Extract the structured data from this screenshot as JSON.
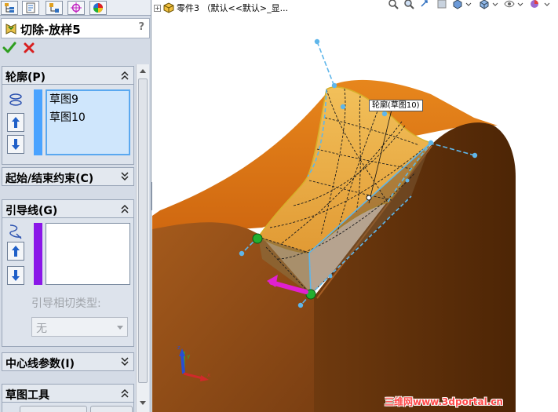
{
  "property_manager": {
    "feature_title": "切除-放样5",
    "help_label": "?",
    "groups": {
      "profile": {
        "title": "轮廓(P)",
        "items": [
          "草图9",
          "草图10"
        ]
      },
      "start_end": {
        "title": "起始/结束约束(C)"
      },
      "guides": {
        "title": "引导线(G)",
        "tangent_type_label": "引导相切类型:",
        "tangent_type_value": "无"
      },
      "centerline": {
        "title": "中心线参数(I)"
      },
      "sketch_tools": {
        "title": "草图工具"
      }
    },
    "colors": {
      "profile_bar": "#4aa3ff",
      "guide_bar": "#8a17e8",
      "ok": "#2e9e1f",
      "cancel": "#d81e1e"
    },
    "icons": [
      "ok-check-icon",
      "cancel-x-icon",
      "collapse-up-icon",
      "collapse-down-icon",
      "move-up-arrow-icon",
      "move-down-arrow-icon",
      "profile-icon",
      "guide-curve-icon"
    ]
  },
  "graphics": {
    "part_name": "零件3 （默认<<默认>_显...",
    "expand_symbol": "+",
    "tooltip": "轮廓(草图10)",
    "watermark": "三维网www.3dportal.cn",
    "triad_axes": {
      "x": "x",
      "y": "y",
      "z": "z"
    },
    "colors": {
      "body_top": "#e07a14",
      "body_side": "#8c4b18",
      "body_dark": "#5e2e07",
      "cut_fill": "#f0b44a",
      "preview_line": "#5fb6ea",
      "handle_green": "#22b030",
      "drag_arrow": "#e020d0"
    }
  }
}
